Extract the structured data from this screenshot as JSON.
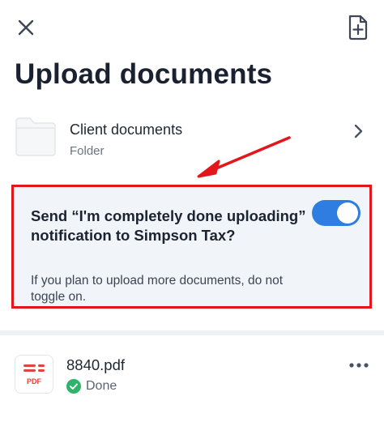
{
  "header": {
    "title": "Upload documents",
    "close_icon": "close-icon",
    "add_icon": "file-plus-icon"
  },
  "folder": {
    "name": "Client documents",
    "type": "Folder",
    "icon": "folder-icon",
    "chevron": "chevron-right-icon"
  },
  "notification": {
    "title": "Send “I'm completely done uploading” notification to Simpson Tax?",
    "description": "If you plan to upload more documents, do not toggle on.",
    "toggle_on": true,
    "highlight_color": "#e3161c",
    "toggle_color": "#2f7de1"
  },
  "files": [
    {
      "name": "8840.pdf",
      "badge": "PDF",
      "status": "Done",
      "status_color": "#2db36b"
    }
  ]
}
